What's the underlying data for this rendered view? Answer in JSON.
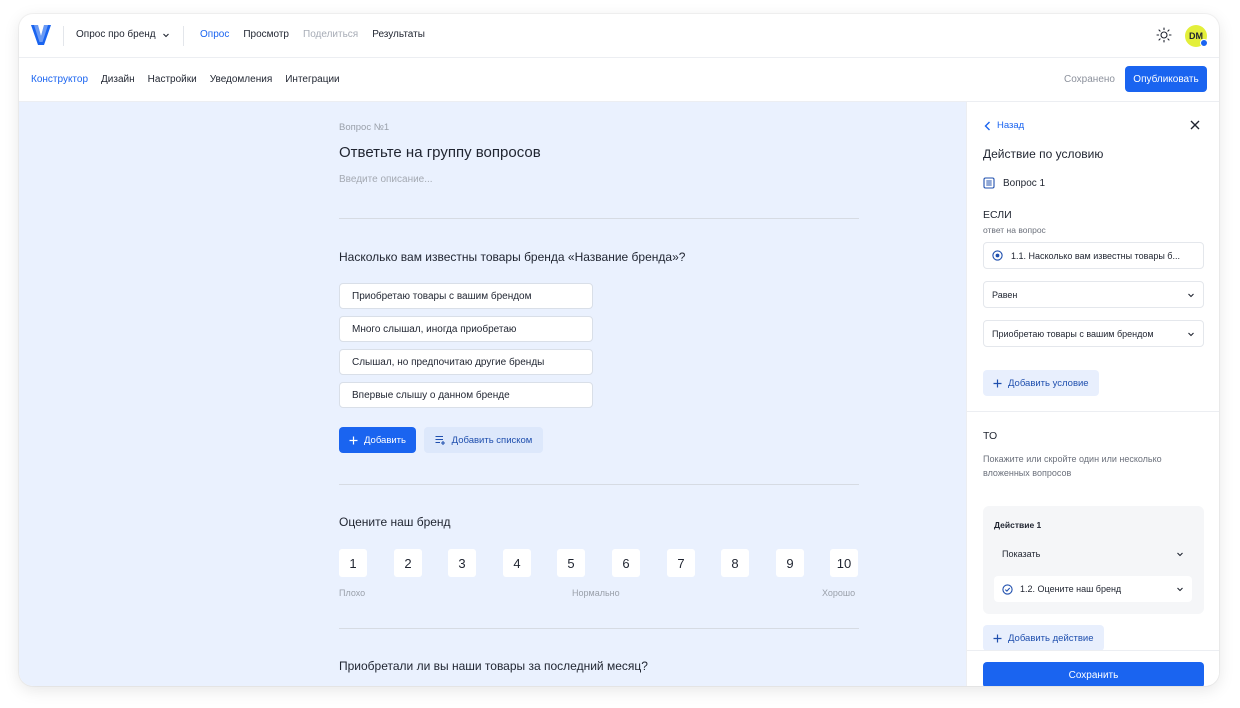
{
  "header": {
    "survey_title": "Опрос про бренд",
    "nav": [
      {
        "label": "Опрос"
      },
      {
        "label": "Просмотр"
      },
      {
        "label": "Поделиться"
      },
      {
        "label": "Результаты"
      }
    ],
    "avatar_initials": "DM"
  },
  "subnav": {
    "tabs": [
      {
        "label": "Конструктор"
      },
      {
        "label": "Дизайн"
      },
      {
        "label": "Настройки"
      },
      {
        "label": "Уведомления"
      },
      {
        "label": "Интеграции"
      }
    ],
    "status": "Сохранено",
    "publish_label": "Опубликовать"
  },
  "main": {
    "question_number": "Вопрос №1",
    "question_title": "Ответьте на группу вопросов",
    "description_placeholder": "Введите описание...",
    "sub1": {
      "title": "Насколько вам известны товары бренда «Название бренда»?",
      "options": [
        "Приобретаю товары с вашим брендом",
        "Много слышал, иногда приобретаю",
        "Слышал, но предпочитаю другие бренды",
        "Впервые слышу о данном бренде"
      ],
      "add_label": "Добавить",
      "add_list_label": "Добавить списком"
    },
    "sub2": {
      "title": "Оцените наш бренд",
      "scale": [
        "1",
        "2",
        "3",
        "4",
        "5",
        "6",
        "7",
        "8",
        "9",
        "10"
      ],
      "low_label": "Плохо",
      "mid_label": "Нормально",
      "high_label": "Хорошо"
    },
    "sub3": {
      "title": "Приобретали ли вы наши товары за последний месяц?"
    }
  },
  "panel": {
    "back_label": "Назад",
    "title": "Действие по условию",
    "question_ref": "Вопрос 1",
    "if_label": "ЕСЛИ",
    "if_sub": "ответ на вопрос",
    "if_question": "1.1. Насколько вам известны товары б...",
    "operator": "Равен",
    "value": "Приобретаю товары с вашим брендом",
    "add_condition_label": "Добавить условие",
    "then_label": "ТО",
    "then_desc": "Покажите или скройте один или несколько вложенных вопросов",
    "action_title": "Действие 1",
    "action_type": "Показать",
    "action_target": "1.2. Оцените наш бренд",
    "add_action_label": "Добавить действие",
    "save_label": "Сохранить"
  },
  "colors": {
    "accent": "#1a64f0",
    "canvas_bg": "#eaf1fe",
    "avatar_bg": "#e3ef3a"
  }
}
